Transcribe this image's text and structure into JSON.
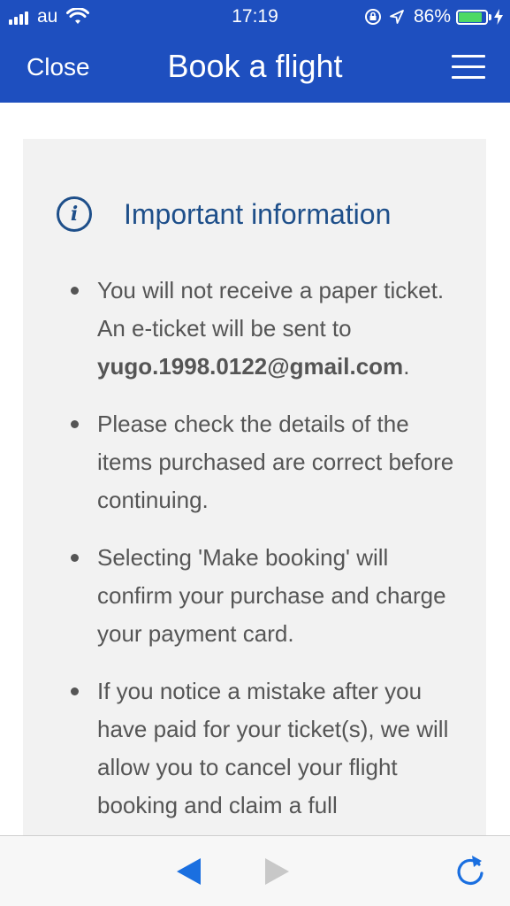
{
  "status_bar": {
    "carrier": "au",
    "time": "17:19",
    "battery": "86%",
    "battery_level": 0.86,
    "icons": [
      "signal-icon",
      "wifi-icon",
      "orientation-lock-icon",
      "location-icon",
      "battery-icon",
      "charging-icon"
    ]
  },
  "nav": {
    "close_label": "Close",
    "title": "Book a flight",
    "menu_icon": "hamburger-menu-icon"
  },
  "info": {
    "icon_glyph": "i",
    "title": "Important information",
    "bullets": [
      {
        "text_before": "You will not receive a paper ticket. An e-ticket will be sent to ",
        "email": "yugo.1998.0122@gmail.com",
        "text_after": "."
      },
      {
        "text": "Please check the details of the items purchased are correct before continuing."
      },
      {
        "text": "Selecting 'Make booking' will confirm your purchase and charge your payment card."
      },
      {
        "text": "If you notice a mistake after you have paid for your ticket(s), we will allow you to cancel your flight booking and claim a full"
      }
    ]
  },
  "toolbar": {
    "icons": [
      "back-icon",
      "forward-icon",
      "refresh-icon"
    ]
  },
  "colors": {
    "brand": "#1e4fbf",
    "info_title": "#1e4f8a",
    "body_text": "#555555",
    "card_bg": "#f2f2f2",
    "toolbar_active": "#1a6fe0",
    "toolbar_disabled": "#c8c8c8",
    "battery_fill": "#4cd964"
  }
}
